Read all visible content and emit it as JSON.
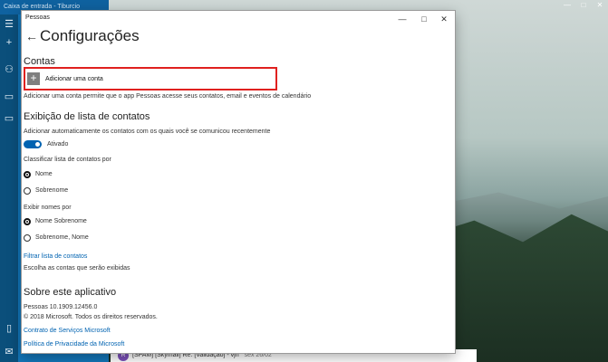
{
  "mail": {
    "title": "Caixa de entrada - Tiburcio",
    "preview": {
      "sender_badge": "R",
      "subject": "[SPAM] [Skymail] Re: [Validação] - vjn",
      "date": "sex 26/02"
    }
  },
  "window": {
    "title": "Pessoas",
    "minimize": "—",
    "maximize": "□",
    "close": "✕"
  },
  "page": {
    "back": "←",
    "title": "Configurações"
  },
  "accounts": {
    "heading": "Contas",
    "add_label": "Adicionar uma conta",
    "description": "Adicionar uma conta permite que o app Pessoas acesse seus contatos, email e eventos de calendário"
  },
  "contacts_display": {
    "heading": "Exibição de lista de contatos",
    "auto_add_label": "Adicionar automaticamente os contatos com os quais você se comunicou recentemente",
    "toggle_state": "Ativado",
    "sort_label": "Classificar lista de contatos por",
    "sort_options": [
      "Nome",
      "Sobrenome"
    ],
    "sort_selected": "Nome",
    "display_label": "Exibir nomes por",
    "display_options": [
      "Nome Sobrenome",
      "Sobrenome, Nome"
    ],
    "display_selected": "Nome Sobrenome",
    "filter_link": "Filtrar lista de contatos",
    "filter_desc": "Escolha as contas que serão exibidas"
  },
  "about": {
    "heading": "Sobre este aplicativo",
    "version": "Pessoas 10.1909.12456.0",
    "copyright": "© 2018 Microsoft. Todos os direitos reservados.",
    "services_link": "Contrato de Serviços Microsoft",
    "privacy_link": "Política de Privacidade da Microsoft"
  },
  "colors": {
    "accent": "#0063b1",
    "highlight": "#e0211f",
    "mail_blue": "#1275b8"
  }
}
